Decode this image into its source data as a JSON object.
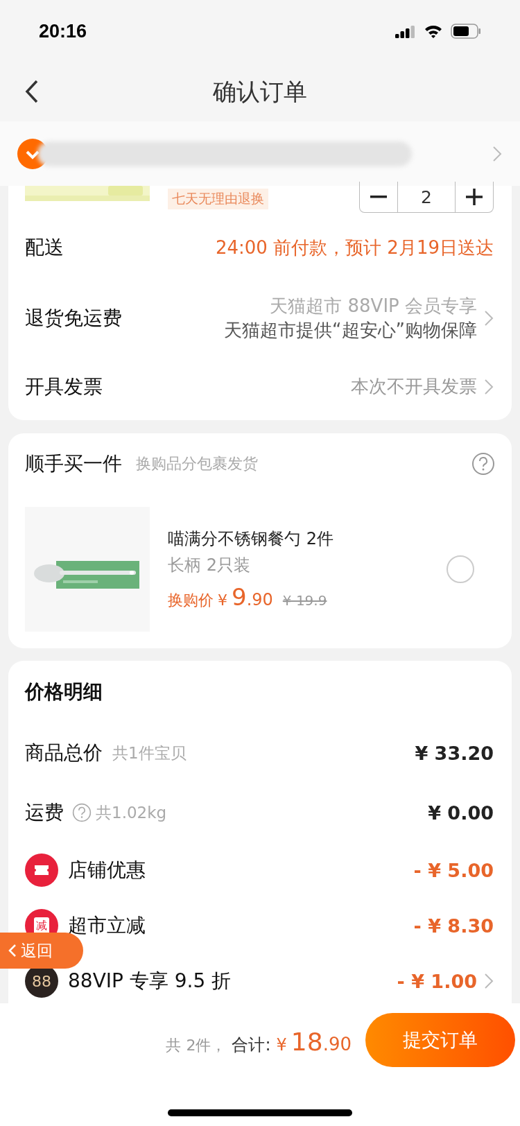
{
  "status_bar": {
    "time": "20:16"
  },
  "nav": {
    "title": "确认订单"
  },
  "product": {
    "tag": "七天无理由退换",
    "quantity": "2"
  },
  "order_rows": [
    {
      "label": "配送",
      "value": "24:00 前付款，预计 2月19日送达",
      "accent": true,
      "chevron": false
    },
    {
      "label": "退货免运费",
      "value": "天猫超市 88VIP 会员专享",
      "note": "天猫超市提供“超安心”购物保障",
      "accent": false,
      "chevron": true
    },
    {
      "label": "开具发票",
      "value": "本次不开具发票",
      "accent": false,
      "chevron": true
    }
  ],
  "add_on": {
    "title": "顺手买一件",
    "subtitle": "换购品分包裹发货",
    "item": {
      "name": "喵满分不锈钢餐勺 2件",
      "spec": "长柄 2只装",
      "price_label": "换购价",
      "currency": "¥",
      "price_int": "9",
      "price_dec": ".90",
      "original_price": "¥ 19.9",
      "selected": false
    }
  },
  "price_detail": {
    "title": "价格明细",
    "rows": [
      {
        "kind": "plain",
        "label": "商品总价",
        "note": "共1件宝贝",
        "amount": "¥ 33.20",
        "help": false,
        "chevron": false
      },
      {
        "kind": "plain",
        "label": "运费",
        "note": "共1.02kg",
        "amount": "¥ 0.00",
        "help": true,
        "chevron": false
      },
      {
        "kind": "coupon",
        "label": "店铺优惠",
        "amount": "- ¥ 5.00",
        "chevron": false
      },
      {
        "kind": "instant",
        "badge": "减",
        "label": "超市立减",
        "amount": "- ¥ 8.30",
        "chevron": false
      },
      {
        "kind": "vip",
        "badge": "88",
        "label": "88VIP 专享 9.5 折",
        "amount": "- ¥ 1.00",
        "chevron": true
      }
    ]
  },
  "footer": {
    "count": "共 2件，",
    "total_label": "合计:",
    "currency": "¥",
    "total_int": "18",
    "total_dec": ".90",
    "submit": "提交订单"
  },
  "float_back": {
    "label": "返回"
  }
}
